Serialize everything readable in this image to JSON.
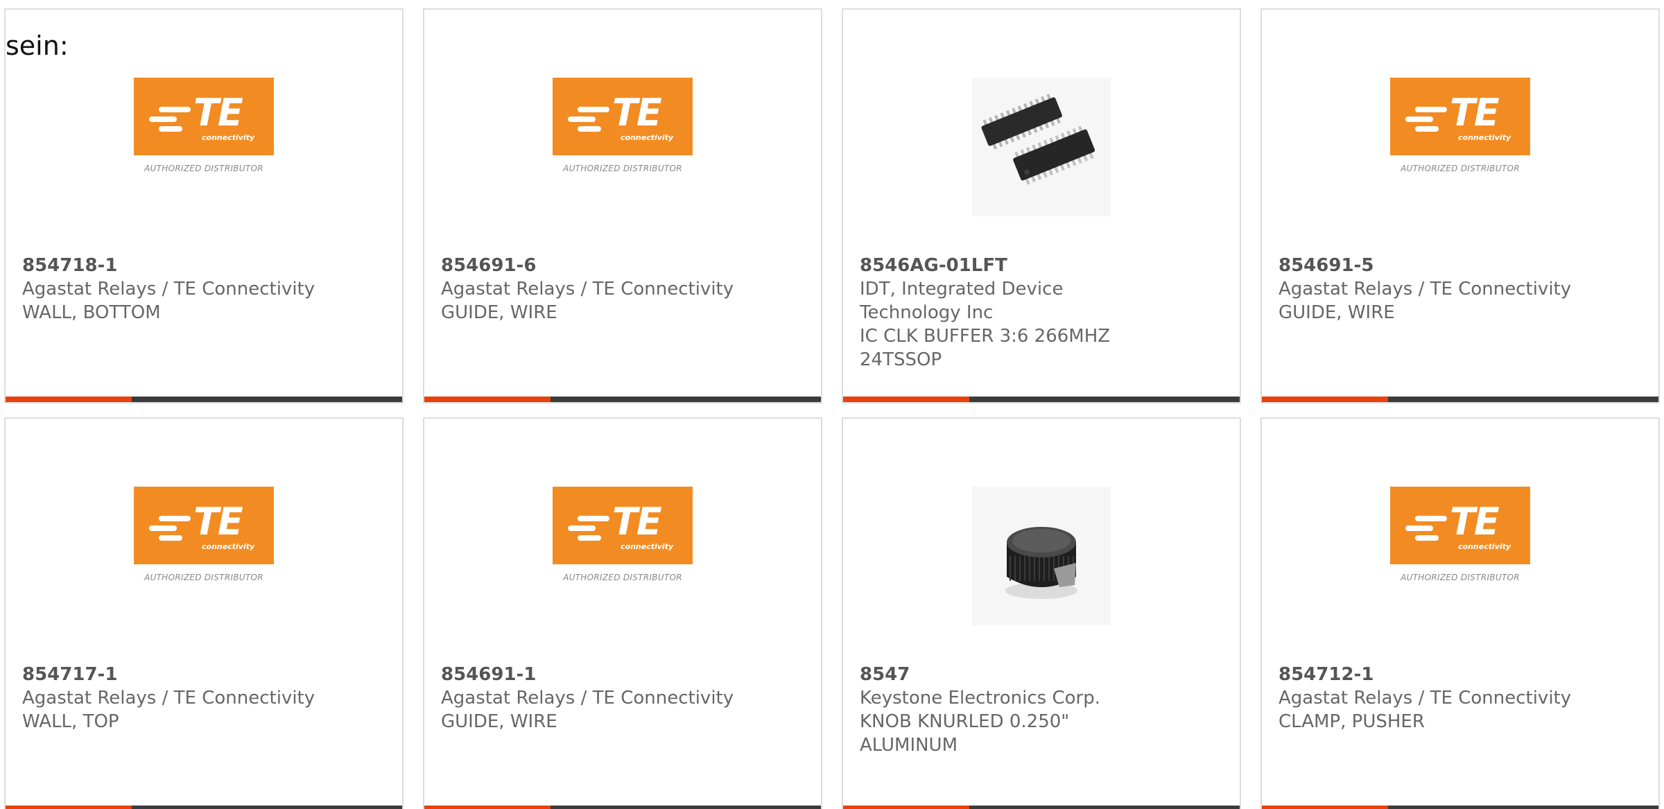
{
  "lead": {
    "text": "sein:"
  },
  "products": [
    {
      "part": "854718-1",
      "manufacturer_lines": [
        "Agastat Relays / TE Connectivity"
      ],
      "description_lines": [
        "WALL, BOTTOM"
      ],
      "image": "te-connectivity-logo",
      "logo_subtext": "connectivity",
      "logo_caption": "AUTHORIZED DISTRIBUTOR"
    },
    {
      "part": "854691-6",
      "manufacturer_lines": [
        "Agastat Relays / TE Connectivity"
      ],
      "description_lines": [
        "GUIDE, WIRE"
      ],
      "image": "te-connectivity-logo",
      "logo_subtext": "connectivity",
      "logo_caption": "AUTHORIZED DISTRIBUTOR"
    },
    {
      "part": "8546AG-01LFT",
      "manufacturer_lines": [
        "IDT, Integrated Device",
        "Technology Inc"
      ],
      "description_lines": [
        "IC CLK BUFFER 3:6 266MHZ",
        "24TSSOP"
      ],
      "image": "ic-chip-photo"
    },
    {
      "part": "854691-5",
      "manufacturer_lines": [
        "Agastat Relays / TE Connectivity"
      ],
      "description_lines": [
        "GUIDE, WIRE"
      ],
      "image": "te-connectivity-logo",
      "logo_subtext": "connectivity",
      "logo_caption": "AUTHORIZED DISTRIBUTOR"
    },
    {
      "part": "854717-1",
      "manufacturer_lines": [
        "Agastat Relays / TE Connectivity"
      ],
      "description_lines": [
        "WALL, TOP"
      ],
      "image": "te-connectivity-logo",
      "logo_subtext": "connectivity",
      "logo_caption": "AUTHORIZED DISTRIBUTOR"
    },
    {
      "part": "854691-1",
      "manufacturer_lines": [
        "Agastat Relays / TE Connectivity"
      ],
      "description_lines": [
        "GUIDE, WIRE"
      ],
      "image": "te-connectivity-logo",
      "logo_subtext": "connectivity",
      "logo_caption": "AUTHORIZED DISTRIBUTOR"
    },
    {
      "part": "8547",
      "manufacturer_lines": [
        "Keystone Electronics Corp."
      ],
      "description_lines": [
        "KNOB KNURLED 0.250\"",
        "ALUMINUM"
      ],
      "image": "knob-photo"
    },
    {
      "part": "854712-1",
      "manufacturer_lines": [
        "Agastat Relays / TE Connectivity"
      ],
      "description_lines": [
        "CLAMP, PUSHER"
      ],
      "image": "te-connectivity-logo",
      "logo_subtext": "connectivity",
      "logo_caption": "AUTHORIZED DISTRIBUTOR"
    }
  ],
  "colors": {
    "accent_bar": "#e8420c",
    "bar": "#3b3b3b",
    "te_orange": "#f28c22",
    "card_border": "#dcdcdc",
    "text": "#666666"
  }
}
